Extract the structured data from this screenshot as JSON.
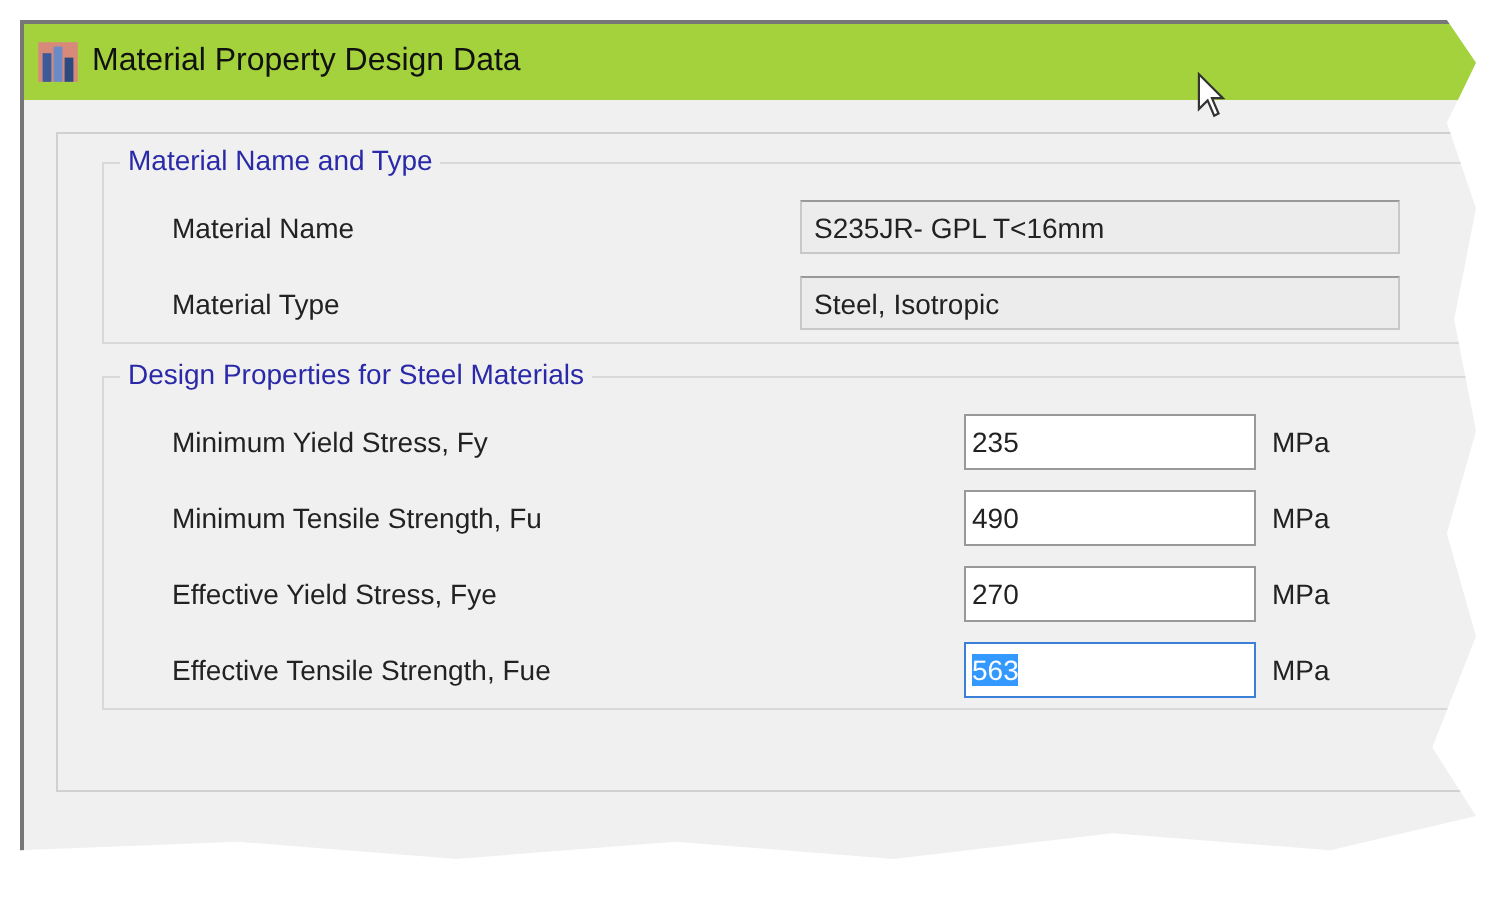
{
  "window": {
    "title": "Material Property Design Data"
  },
  "groups": [
    {
      "title": "Material Name and Type",
      "rows": [
        {
          "kind": "readonly",
          "label": "Material Name",
          "value": "S235JR- GPL T<16mm"
        },
        {
          "kind": "readonly",
          "label": "Material Type",
          "value": "Steel, Isotropic"
        }
      ]
    },
    {
      "title": "Design Properties for Steel Materials",
      "rows": [
        {
          "kind": "input",
          "label": "Minimum Yield Stress, Fy",
          "value": "235",
          "unit": "MPa",
          "selected": false
        },
        {
          "kind": "input",
          "label": "Minimum Tensile Strength, Fu",
          "value": "490",
          "unit": "MPa",
          "selected": false
        },
        {
          "kind": "input",
          "label": "Effective Yield Stress, Fye",
          "value": "270",
          "unit": "MPa",
          "selected": false
        },
        {
          "kind": "input",
          "label": "Effective Tensile Strength, Fue",
          "value": "563",
          "unit": "MPa",
          "selected": true
        }
      ]
    }
  ]
}
